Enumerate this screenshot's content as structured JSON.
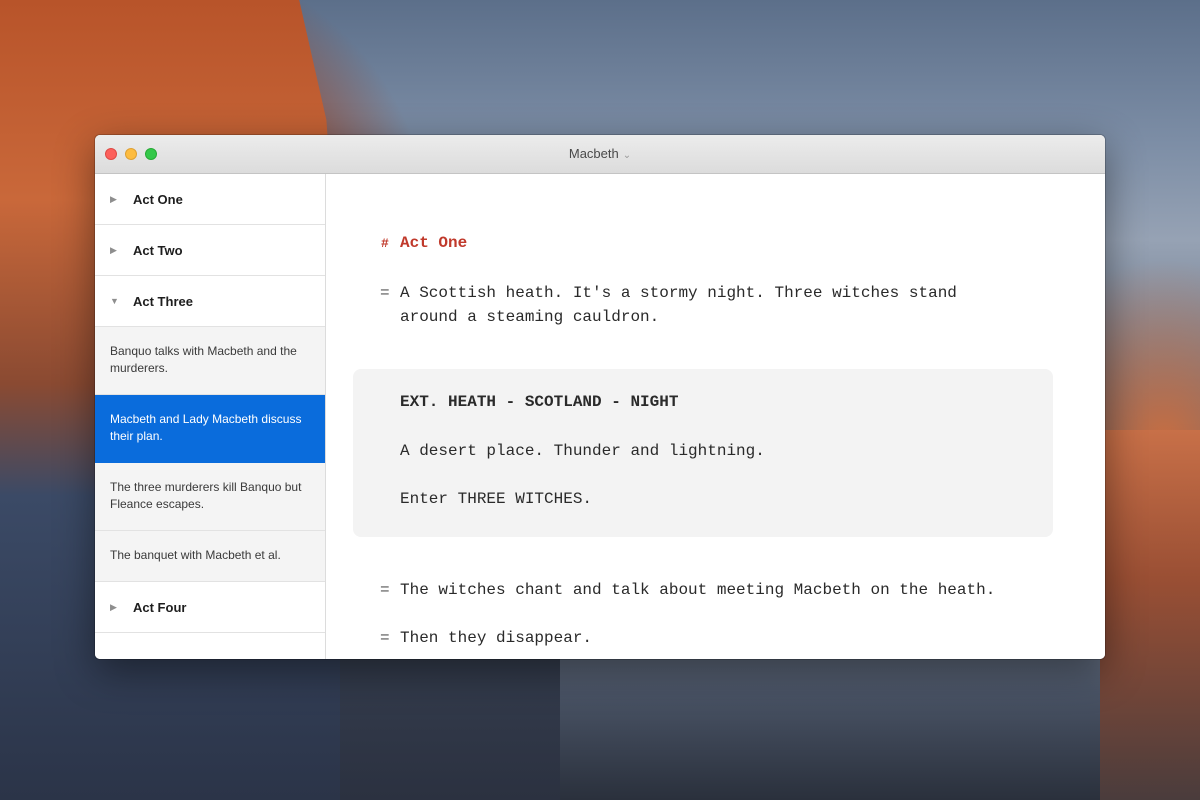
{
  "window": {
    "title": "Macbeth",
    "title_chevron": "⌄"
  },
  "sidebar": {
    "acts": [
      {
        "label": "Act One",
        "expanded": false
      },
      {
        "label": "Act Two",
        "expanded": false
      },
      {
        "label": "Act Three",
        "expanded": true
      },
      {
        "label": "Act Four",
        "expanded": false
      }
    ],
    "scenes": [
      {
        "text": "Banquo talks with Macbeth and the murderers.",
        "selected": false
      },
      {
        "text": "Macbeth and Lady Macbeth discuss their plan.",
        "selected": true
      },
      {
        "text": "The three murderers kill Banquo but Fleance escapes.",
        "selected": false
      },
      {
        "text": "The banquet with Macbeth et al.",
        "selected": false
      }
    ],
    "collapsed_triangle": "▶",
    "expanded_triangle": "▼"
  },
  "editor": {
    "heading_marker": "#",
    "heading": "Act One",
    "synopsis_marker": "=",
    "synopsis_1_line_1": "A Scottish heath. It's a stormy night. Three witches stand",
    "synopsis_1_line_2": "around a steaming cauldron.",
    "scene_heading": "EXT. HEATH - SCOTLAND - NIGHT",
    "action_1": "A desert place. Thunder and lightning.",
    "action_2": "Enter THREE WITCHES.",
    "synopsis_2": "The witches chant and talk about meeting Macbeth on the heath.",
    "synopsis_3": "Then they disappear."
  },
  "colors": {
    "selection": "#0a6cdc",
    "heading": "#c0392b"
  }
}
